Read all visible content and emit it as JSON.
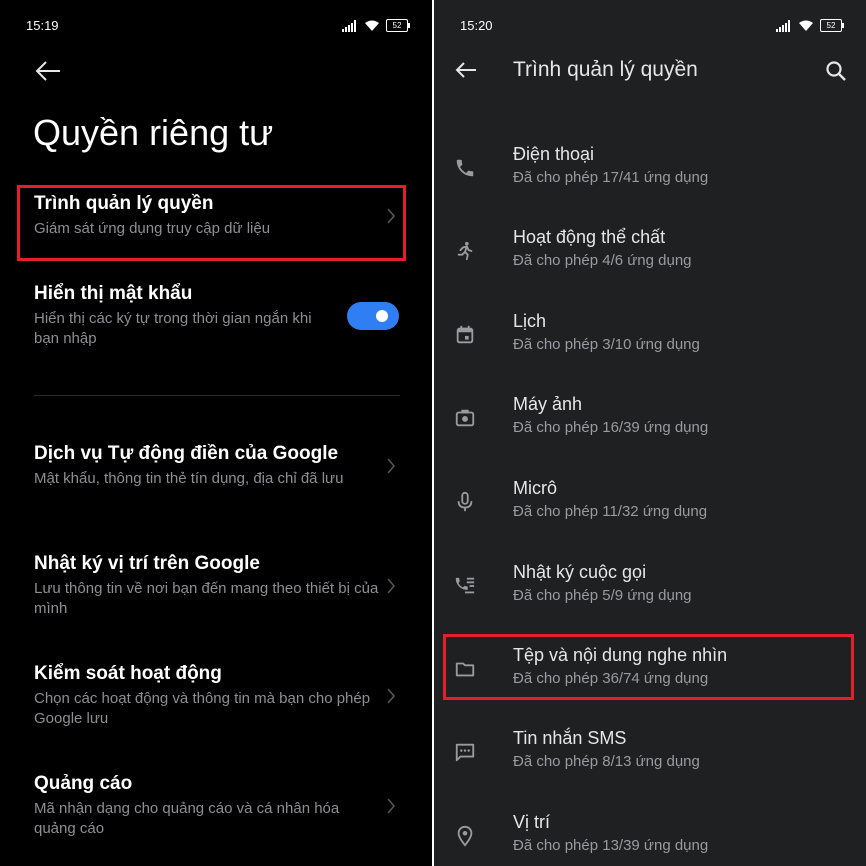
{
  "left": {
    "status_time": "15:19",
    "battery": "52",
    "title": "Quyền riêng tư",
    "items": [
      {
        "title": "Trình quản lý quyền",
        "subtitle": "Giám sát ứng dụng truy cập dữ liệu"
      },
      {
        "title": "Hiển thị mật khẩu",
        "subtitle": "Hiển thị các ký tự trong thời gian ngắn khi bạn nhập",
        "toggle_on": true
      },
      {
        "title": "Dịch vụ Tự động điền của Google",
        "subtitle": "Mật khẩu, thông tin thẻ tín dụng, địa chỉ đã lưu"
      },
      {
        "title": "Nhật ký vị trí trên Google",
        "subtitle": "Lưu thông tin về nơi bạn đến mang theo thiết bị của mình"
      },
      {
        "title": "Kiểm soát hoạt động",
        "subtitle": "Chọn các hoạt động và thông tin mà bạn cho phép Google lưu"
      },
      {
        "title": "Quảng cáo",
        "subtitle": "Mã nhận dạng cho quảng cáo và cá nhân hóa quảng cáo"
      }
    ]
  },
  "right": {
    "status_time": "15:20",
    "battery": "52",
    "title": "Trình quản lý quyền",
    "items": [
      {
        "icon": "phone-icon",
        "title": "Điện thoại",
        "subtitle": "Đã cho phép 17/41 ứng dụng"
      },
      {
        "icon": "running-person-icon",
        "title": "Hoạt động thể chất",
        "subtitle": "Đã cho phép 4/6 ứng dụng"
      },
      {
        "icon": "calendar-icon",
        "title": "Lịch",
        "subtitle": "Đã cho phép 3/10 ứng dụng"
      },
      {
        "icon": "camera-icon",
        "title": "Máy ảnh",
        "subtitle": "Đã cho phép 16/39 ứng dụng"
      },
      {
        "icon": "microphone-icon",
        "title": "Micrô",
        "subtitle": "Đã cho phép 11/32 ứng dụng"
      },
      {
        "icon": "call-log-icon",
        "title": "Nhật ký cuộc gọi",
        "subtitle": "Đã cho phép 5/9 ứng dụng"
      },
      {
        "icon": "folder-icon",
        "title": "Tệp và nội dung nghe nhìn",
        "subtitle": "Đã cho phép 36/74 ứng dụng"
      },
      {
        "icon": "sms-icon",
        "title": "Tin nhắn SMS",
        "subtitle": "Đã cho phép 8/13 ứng dụng"
      },
      {
        "icon": "location-pin-icon",
        "title": "Vị trí",
        "subtitle": "Đã cho phép 13/39 ứng dụng"
      }
    ]
  },
  "colors": {
    "highlight": "#e2202a",
    "toggle_accent": "#2f7ef3"
  }
}
